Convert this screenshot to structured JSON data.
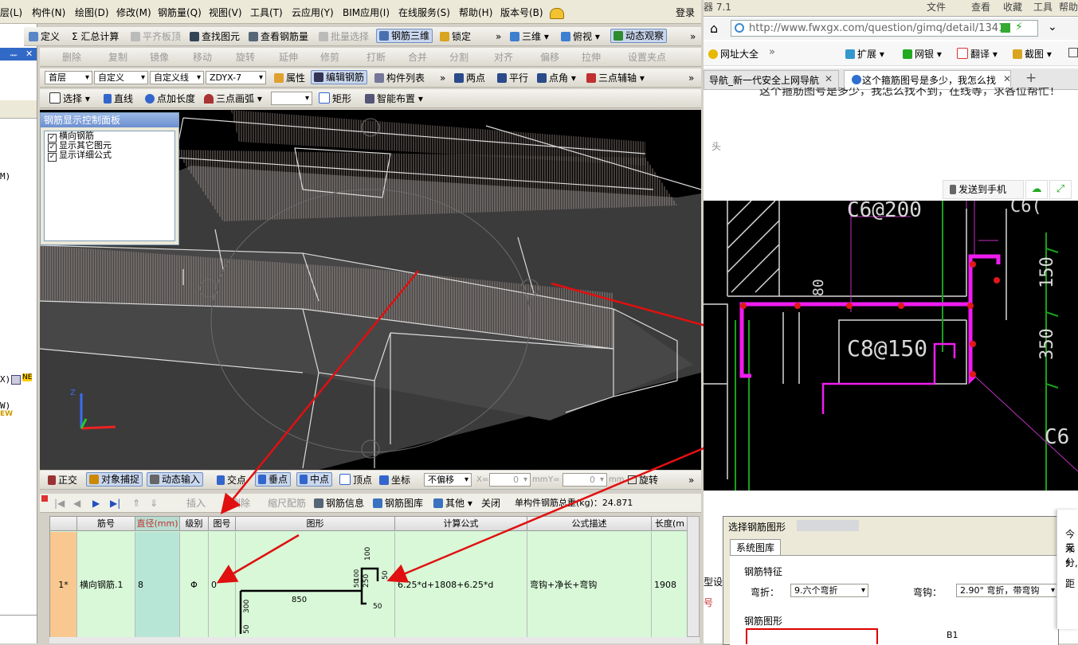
{
  "app": {
    "menu": [
      "层(L)",
      "构件(N)",
      "绘图(D)",
      "修改(M)",
      "钢筋量(Q)",
      "视图(V)",
      "工具(T)",
      "云应用(Y)",
      "BIM应用(I)",
      "在线服务(S)",
      "帮助(H)",
      "版本号(B)"
    ],
    "login": "登录"
  },
  "toolbar1": {
    "define": "定义",
    "sum": "Σ 汇总计算",
    "flat_slab": "平齐板顶",
    "find": "查找图元",
    "view_rebar": "查看钢筋量",
    "batch_select": "批量选择",
    "rebar3d": "钢筋三维",
    "lock": "锁定",
    "view3d": "三维",
    "top_view": "俯视",
    "dynamic": "动态观察"
  },
  "toolbar2": {
    "delete": "删除",
    "copy": "复制",
    "mirror": "镜像",
    "move": "移动",
    "rotate": "旋转",
    "extend": "延伸",
    "trim": "修剪",
    "break": "打断",
    "merge": "合并",
    "split": "分割",
    "align": "对齐",
    "offset": "偏移",
    "stretch": "拉伸",
    "set_point": "设置夹点"
  },
  "toolbar3": {
    "floor": "首层",
    "custom": "自定义",
    "custom_line": "自定义线",
    "element": "ZDYX-7",
    "property": "属性",
    "edit_rebar": "编辑钢筋",
    "list": "构件列表",
    "two_point": "两点",
    "parallel": "平行",
    "point_angle": "点角",
    "three_axis": "三点辅轴"
  },
  "toolbar4": {
    "select": "选择",
    "line": "直线",
    "point_len": "点加长度",
    "arc": "三点画弧",
    "rect": "矩形",
    "smart": "智能布置"
  },
  "panel": {
    "title": "钢筋显示控制面板",
    "items": [
      "横向钢筋",
      "显示其它图元",
      "显示详细公式"
    ]
  },
  "left_fragments": {
    "m": "M)",
    "x": "X)",
    "ne": "NE",
    "w": "W)",
    "ew": "EW"
  },
  "snap": {
    "ortho": "正交",
    "object_snap": "对象捕捉",
    "dynamic_input": "动态输入",
    "intersect": "交点",
    "perp": "垂点",
    "mid": "中点",
    "vertex": "顶点",
    "coord": "坐标",
    "no_offset": "不偏移",
    "x_label": "X=",
    "x_val": "0",
    "y_label": "Y=",
    "y_val": "0",
    "mm1": "mm",
    "mm2": "mm",
    "rotate": "旋转"
  },
  "grid_toolbar": {
    "insert": "插入",
    "delete": "删除",
    "scale": "缩尺配筋",
    "info": "钢筋信息",
    "library": "钢筋图库",
    "other": "其他",
    "close": "关闭",
    "total": "单构件钢筋总重(kg)：24.871"
  },
  "grid": {
    "headers": [
      "筋号",
      "直径(mm)",
      "级别",
      "图号",
      "图形",
      "计算公式",
      "公式描述",
      "长度(m"
    ],
    "row": {
      "index": "1*",
      "name": "横向钢筋.1",
      "diameter": "8",
      "grade": "Φ",
      "shape_no": "0",
      "formula": "6.25*d+1808+6.25*d",
      "desc": "弯钩+净长+弯钩",
      "length": "1908"
    },
    "shape_labels": {
      "d100": "100",
      "d50a": "50",
      "d250": "250",
      "d50b": "50",
      "d850": "850",
      "d300": "300",
      "d50c": "50",
      "d50d": "50",
      "d100b": "100"
    }
  },
  "browser": {
    "menu": [
      "器 7.1",
      "文件",
      "查看",
      "收藏",
      "工具",
      "帮助"
    ],
    "url": "http://www.fwxgx.com/question/gimq/detail/1341",
    "fav": "网址大全",
    "ext": "扩展",
    "bank": "网银",
    "translate": "翻译",
    "screenshot": "截图",
    "tab1": "导航_新一代安全上网导航",
    "tab2": "这个箍筋图号是多少，我怎么找",
    "question": "这个箍筋图号是多少，我怎么找不到，在线等，求各位帮忙！",
    "head_label": "头",
    "send_phone": "发送到手机",
    "cad": {
      "t1": "C6@200",
      "t2": "C6(",
      "t3": "C8@150",
      "t4": "80",
      "t5": "150",
      "t6": "350",
      "t7": "C6"
    }
  },
  "dialog": {
    "title": "选择钢筋图形",
    "tab": "系统图库",
    "feature": "钢筋特征",
    "bend_label": "弯折：",
    "bend_val": "9.六个弯折",
    "hook_label": "弯钩：",
    "hook_val": "2.90° 弯折，带弯钩",
    "shape": "钢筋图形",
    "b1": "B1"
  },
  "right_edge": {
    "a": "今元",
    "b": "采纟",
    "c": "分,",
    "d": "距"
  },
  "left_side": {
    "type": "型设",
    "no": "号"
  }
}
